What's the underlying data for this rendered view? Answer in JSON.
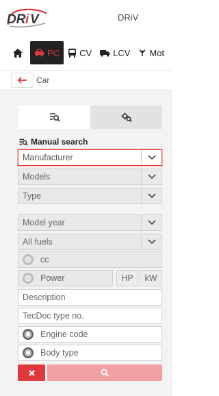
{
  "header": {
    "logo_text": "DRiV",
    "brand_name": "DRiV"
  },
  "nav": {
    "items": [
      {
        "label": "PC",
        "icon": "car-icon",
        "active": true
      },
      {
        "label": "CV",
        "icon": "bus-icon",
        "active": false
      },
      {
        "label": "LCV",
        "icon": "truck-icon",
        "active": false
      },
      {
        "label": "Mot",
        "icon": "motorcycle-icon",
        "active": false
      }
    ]
  },
  "breadcrumb": {
    "label": "Car"
  },
  "tabs": [
    {
      "icon": "manual-search-icon",
      "active": true
    },
    {
      "icon": "vehicle-settings-icon",
      "active": false
    }
  ],
  "form": {
    "section_title": "Manual search",
    "manufacturer": "Manufacturer",
    "models": "Models",
    "type": "Type",
    "model_year": "Model year",
    "fuels": "All fuels",
    "cc": "cc",
    "power": "Power",
    "unit_hp": "HP",
    "unit_kw": "kW",
    "description_placeholder": "Description",
    "tecdoc_placeholder": "TecDoc type no.",
    "engine_code": "Engine code",
    "body_type": "Body type"
  },
  "colors": {
    "accent": "#e0393d",
    "search_button": "#f3a0a2",
    "panel": "#f3f3f3"
  }
}
